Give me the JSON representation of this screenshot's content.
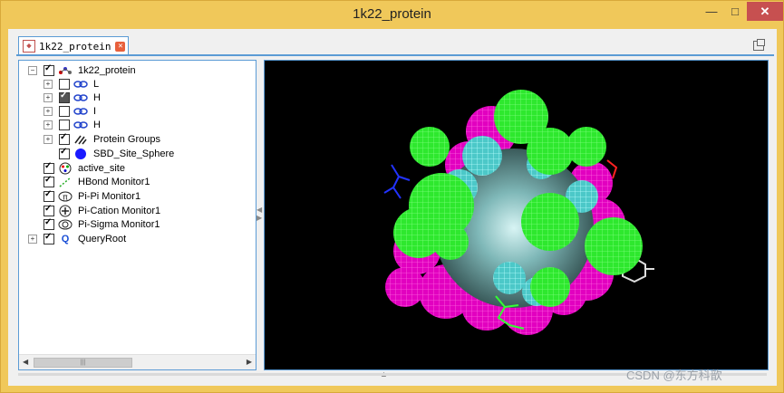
{
  "window": {
    "title": "1k22_protein",
    "minimize_glyph": "—",
    "maximize_glyph": "□",
    "close_glyph": "✕"
  },
  "tab": {
    "label": "1k22_protein",
    "close_glyph": "✕"
  },
  "tree": {
    "root": {
      "label": "1k22_protein",
      "expander": "−"
    },
    "chains": [
      {
        "label": "L",
        "checked": false
      },
      {
        "label": "H",
        "checked": true
      },
      {
        "label": "I",
        "checked": false
      },
      {
        "label": "H",
        "checked": false
      }
    ],
    "protein_groups": {
      "label": "Protein Groups"
    },
    "sbd_site_sphere": {
      "label": "SBD_Site_Sphere"
    },
    "active_site": {
      "label": "active_site"
    },
    "monitors": [
      {
        "label": "HBond Monitor1",
        "icon": "hbond-icon"
      },
      {
        "label": "Pi-Pi Monitor1",
        "icon": "pi-pi-icon"
      },
      {
        "label": "Pi-Cation Monitor1",
        "icon": "pi-cation-icon"
      },
      {
        "label": "Pi-Sigma Monitor1",
        "icon": "pi-sigma-icon"
      }
    ],
    "query_root": {
      "label": "QueryRoot",
      "icon_text": "Q"
    },
    "expand_glyph": "+"
  },
  "scrollbar": {
    "left_glyph": "◀",
    "right_glyph": "▶",
    "thumb_glyph": "|||"
  },
  "colors": {
    "title_bar": "#f0c85a",
    "viewer_bg": "#000000",
    "magenta": "#ff00cc",
    "green": "#33ff33",
    "cyan": "#66e8e8"
  },
  "watermark": "CSDN @东方科歆"
}
